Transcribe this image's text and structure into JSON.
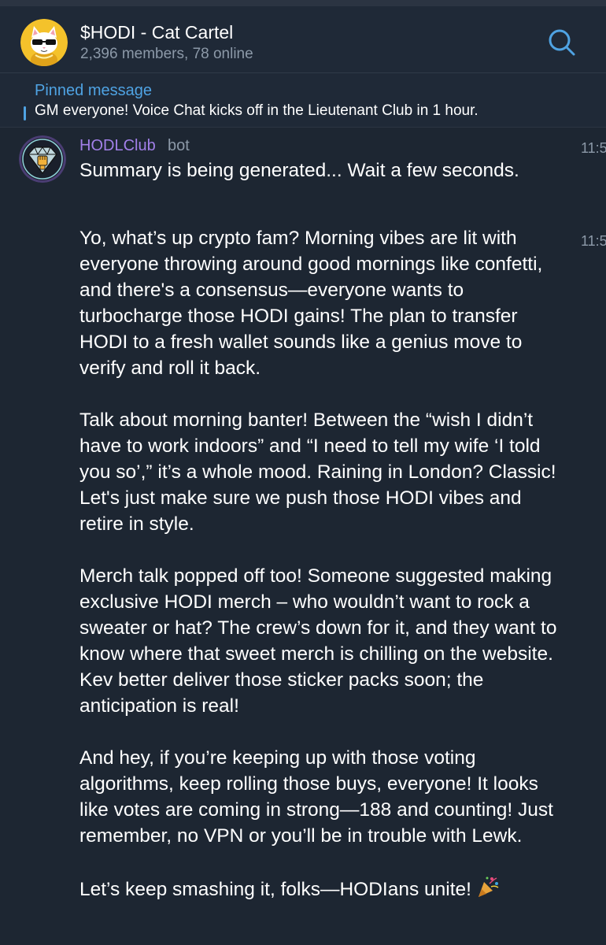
{
  "header": {
    "title": "$HODI - Cat Cartel",
    "subtitle": "2,396 members, 78 online",
    "avatar_icon": "cat-with-sunglasses-avatar",
    "search_icon": "search-icon"
  },
  "pinned": {
    "label": "Pinned message",
    "text": "GM everyone!  Voice Chat kicks off in the Lieutenant Club in 1 hour."
  },
  "messages": [
    {
      "sender": "HODLClub",
      "tag": "bot",
      "time": "11:5",
      "avatar_icon": "diamond-fist-avatar",
      "paragraphs": [
        "Summary is being generated... Wait a few seconds."
      ]
    },
    {
      "time": "11:5",
      "paragraphs": [
        "Yo, what’s up crypto fam? Morning vibes are lit with everyone throwing around good mornings like confetti, and there's a consensus—everyone wants to turbocharge those HODI gains! The plan to transfer HODI to a fresh wallet sounds like a genius move to verify and roll it back.",
        "Talk about morning banter! Between the “wish I didn’t have to work indoors” and “I need to tell my wife ‘I told you so’,” it’s a whole mood. Raining in London? Classic! Let's just make sure we push those HODI vibes and retire in style.",
        "Merch talk popped off too! Someone suggested making exclusive HODI merch – who wouldn’t want to rock a sweater or hat? The crew’s down for it, and they want to know where that sweet merch is chilling on the website. Kev better deliver those sticker packs soon; the anticipation is real!",
        "And hey, if you’re keeping up with those voting algorithms, keep rolling those buys, everyone! It looks like votes are coming in strong—188 and counting! Just remember, no VPN or you’ll be in trouble with Lewk.",
        "Let’s keep smashing it, folks—HODIans unite!"
      ],
      "trailing_icon": "party-popper-icon"
    }
  ],
  "colors": {
    "background": "#1d2632",
    "header_bg": "#1f2937",
    "accent_blue": "#4fa3e3",
    "sender_purple": "#a280e9",
    "muted": "#8c99a8"
  }
}
